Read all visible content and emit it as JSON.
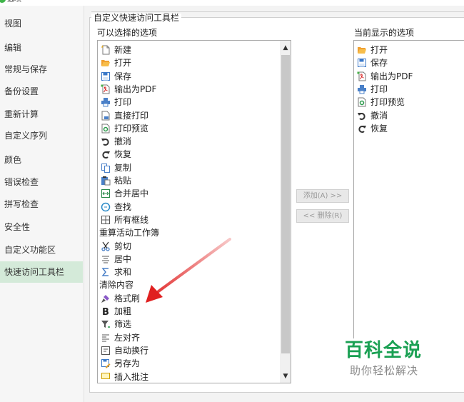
{
  "window": {
    "title": "选项"
  },
  "sidebar": {
    "items": [
      {
        "label": "视图"
      },
      {
        "label": "编辑"
      },
      {
        "label": "常规与保存"
      },
      {
        "label": "备份设置"
      },
      {
        "label": "重新计算"
      },
      {
        "label": "自定义序列"
      },
      {
        "label": "颜色"
      },
      {
        "label": "错误检查"
      },
      {
        "label": "拼写检查"
      },
      {
        "label": "安全性"
      },
      {
        "label": "自定义功能区"
      },
      {
        "label": "快速访问工具栏"
      }
    ],
    "active_index": 11
  },
  "panel": {
    "group_title": "自定义快速访问工具栏",
    "available_label": "可以选择的选项",
    "current_label": "当前显示的选项",
    "add_button": "添加(A) >>",
    "remove_button": "<< 删除(R)"
  },
  "available_items": [
    {
      "label": "新建",
      "icon": "new-doc-icon"
    },
    {
      "label": "打开",
      "icon": "folder-open-icon"
    },
    {
      "label": "保存",
      "icon": "save-icon"
    },
    {
      "label": "输出为PDF",
      "icon": "pdf-icon"
    },
    {
      "label": "打印",
      "icon": "printer-icon"
    },
    {
      "label": "直接打印",
      "icon": "direct-print-icon"
    },
    {
      "label": "打印预览",
      "icon": "print-preview-icon"
    },
    {
      "label": "撤消",
      "icon": "undo-icon"
    },
    {
      "label": "恢复",
      "icon": "redo-icon"
    },
    {
      "label": "复制",
      "icon": "copy-icon"
    },
    {
      "label": "粘贴",
      "icon": "paste-icon"
    },
    {
      "label": "合并居中",
      "icon": "merge-center-icon"
    },
    {
      "label": "查找",
      "icon": "find-icon"
    },
    {
      "label": "所有框线",
      "icon": "all-borders-icon"
    },
    {
      "label": "重算活动工作簿",
      "icon": ""
    },
    {
      "label": "剪切",
      "icon": "cut-icon"
    },
    {
      "label": "居中",
      "icon": "align-center-icon"
    },
    {
      "label": "求和",
      "icon": "sum-icon"
    },
    {
      "label": "清除内容",
      "icon": ""
    },
    {
      "label": "格式刷",
      "icon": "format-painter-icon"
    },
    {
      "label": "加粗",
      "icon": "bold-icon"
    },
    {
      "label": "筛选",
      "icon": "filter-icon"
    },
    {
      "label": "左对齐",
      "icon": "align-left-icon"
    },
    {
      "label": "自动换行",
      "icon": "wrap-text-icon"
    },
    {
      "label": "另存为",
      "icon": "save-as-icon"
    },
    {
      "label": "插入批注",
      "icon": "comment-icon"
    }
  ],
  "current_items": [
    {
      "label": "打开",
      "icon": "folder-open-icon"
    },
    {
      "label": "保存",
      "icon": "save-icon"
    },
    {
      "label": "输出为PDF",
      "icon": "pdf-icon"
    },
    {
      "label": "打印",
      "icon": "printer-icon"
    },
    {
      "label": "打印预览",
      "icon": "print-preview-icon"
    },
    {
      "label": "撤消",
      "icon": "undo-icon"
    },
    {
      "label": "恢复",
      "icon": "redo-icon"
    }
  ],
  "watermark": {
    "title": "百科全说",
    "subtitle": "助你轻松解决"
  },
  "colors": {
    "accent_green": "#1aa053",
    "annotation_red": "#e02020",
    "active_nav": "#d4ead9"
  }
}
